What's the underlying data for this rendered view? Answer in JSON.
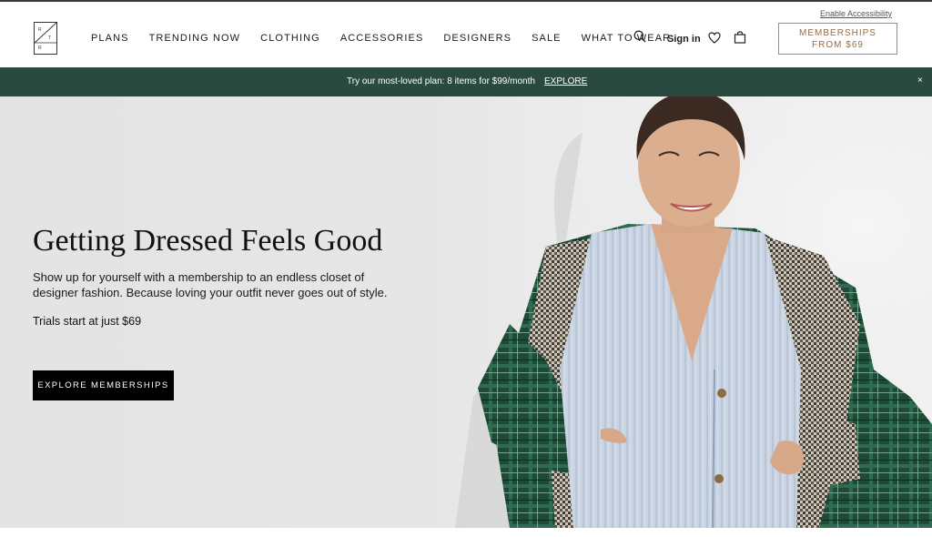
{
  "header": {
    "logo_letters": [
      "R",
      "T",
      "R"
    ],
    "nav": [
      "PLANS",
      "TRENDING NOW",
      "CLOTHING",
      "ACCESSORIES",
      "DESIGNERS",
      "SALE",
      "WHAT TO WEAR"
    ],
    "signin_label": "Sign in",
    "accessibility_link": "Enable Accessibility",
    "membership_cta": {
      "line1": "MEMBERSHIPS",
      "line2": "FROM $69"
    },
    "icons": [
      "search-icon",
      "heart-icon",
      "bag-icon"
    ]
  },
  "banner": {
    "message": "Try our most-loved plan: 8 items for $99/month",
    "link_label": "EXPLORE",
    "close_glyph": "×",
    "background": "#2a4a40"
  },
  "hero": {
    "title": "Getting Dressed Feels Good",
    "subtitle": "Show up for yourself with a membership to an endless closet of designer fashion. Because loving your outfit never goes out of style.",
    "trial_text": "Trials start at just $69",
    "button_label": "EXPLORE MEMBERSHIPS"
  },
  "colors": {
    "accent_gold": "#9a6b41",
    "banner_green": "#2a4a40",
    "button_black": "#000000"
  }
}
